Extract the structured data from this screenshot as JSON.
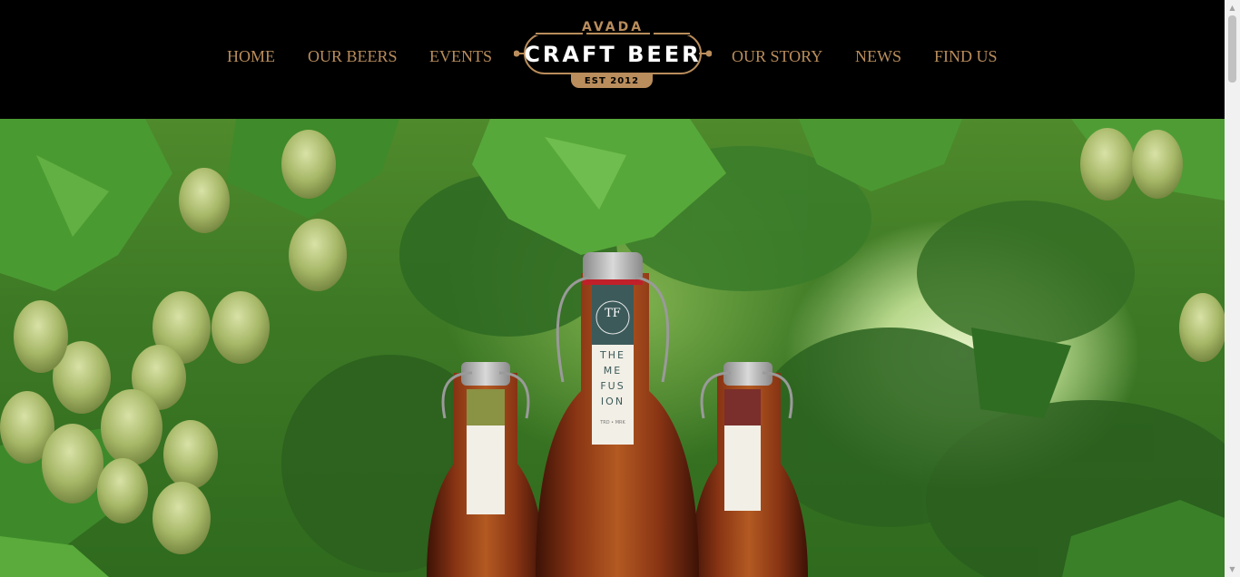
{
  "nav": {
    "home": "HOME",
    "our_beers": "OUR BEERS",
    "events": "EVENTS",
    "our_story": "OUR STORY",
    "news": "NEWS",
    "find_us": "FIND US"
  },
  "logo": {
    "top": "AVADA",
    "main": "CRAFT BEER",
    "est": "EST 2012"
  },
  "bottle_label": {
    "monogram": "TF",
    "line1": "THE",
    "line2": "ME",
    "line3": "FUS",
    "line4": "ION",
    "footer": "TRD • MRK"
  },
  "colors": {
    "accent": "#b98d5c",
    "header_bg": "#000000",
    "label_center": "#3c5a5a",
    "label_left": "#8a9244",
    "label_right": "#7a2f2c"
  }
}
